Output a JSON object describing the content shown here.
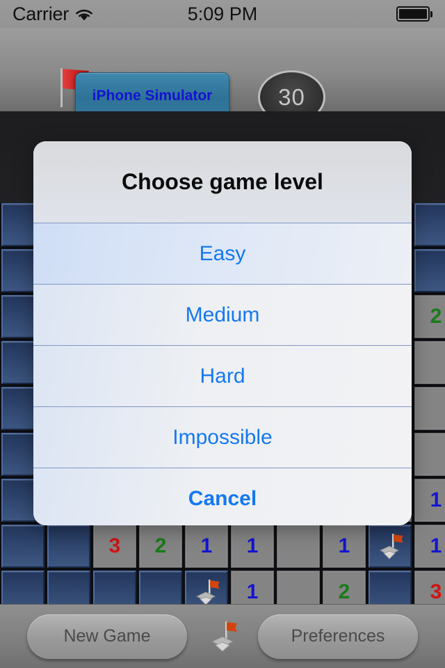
{
  "status_bar": {
    "carrier": "Carrier",
    "wifi_icon": "wifi-icon",
    "time": "5:09 PM",
    "battery_icon": "battery-full-icon"
  },
  "header": {
    "title_button_label": "iPhone Simulator",
    "flag_icon": "red-flag-icon",
    "mine_counter_value": "30"
  },
  "action_sheet": {
    "title": "Choose game level",
    "items": [
      {
        "label": "Easy",
        "highlighted": true,
        "style": "default"
      },
      {
        "label": "Medium",
        "highlighted": false,
        "style": "default"
      },
      {
        "label": "Hard",
        "highlighted": false,
        "style": "default"
      },
      {
        "label": "Impossible",
        "highlighted": false,
        "style": "default"
      },
      {
        "label": "Cancel",
        "highlighted": false,
        "style": "cancel"
      }
    ],
    "accent_color": "#1478f0"
  },
  "toolbar": {
    "new_game_label": "New Game",
    "preferences_label": "Preferences",
    "center_icon": "flag-on-mine-icon"
  },
  "board": {
    "columns": 10,
    "cell_size": 64,
    "colors": {
      "one": "#1414d2",
      "two": "#1a7a1a",
      "three": "#d01414"
    },
    "rows": [
      {
        "cells": [
          {
            "state": "covered",
            "value": ""
          },
          {
            "state": "covered",
            "value": ""
          },
          {
            "state": "covered",
            "value": ""
          },
          {
            "state": "covered",
            "value": ""
          },
          {
            "state": "covered",
            "value": ""
          },
          {
            "state": "covered",
            "value": ""
          },
          {
            "state": "covered",
            "value": ""
          },
          {
            "state": "covered",
            "value": ""
          },
          {
            "state": "covered",
            "value": ""
          },
          {
            "state": "covered",
            "value": ""
          }
        ]
      },
      {
        "cells": [
          {
            "state": "covered",
            "value": ""
          },
          {
            "state": "covered",
            "value": ""
          },
          {
            "state": "covered",
            "value": ""
          },
          {
            "state": "covered",
            "value": ""
          },
          {
            "state": "covered",
            "value": ""
          },
          {
            "state": "covered",
            "value": ""
          },
          {
            "state": "covered",
            "value": ""
          },
          {
            "state": "covered",
            "value": ""
          },
          {
            "state": "covered",
            "value": ""
          },
          {
            "state": "covered",
            "value": ""
          }
        ]
      },
      {
        "cells": [
          {
            "state": "covered",
            "value": ""
          },
          {
            "state": "covered",
            "value": ""
          },
          {
            "state": "revealed",
            "value": ""
          },
          {
            "state": "revealed",
            "value": ""
          },
          {
            "state": "revealed",
            "value": ""
          },
          {
            "state": "revealed",
            "value": ""
          },
          {
            "state": "revealed",
            "value": ""
          },
          {
            "state": "revealed",
            "value": ""
          },
          {
            "state": "revealed",
            "value": ""
          },
          {
            "state": "revealed",
            "value": "2"
          }
        ]
      },
      {
        "cells": [
          {
            "state": "covered",
            "value": ""
          },
          {
            "state": "covered",
            "value": ""
          },
          {
            "state": "revealed",
            "value": ""
          },
          {
            "state": "revealed",
            "value": ""
          },
          {
            "state": "revealed",
            "value": ""
          },
          {
            "state": "revealed",
            "value": ""
          },
          {
            "state": "revealed",
            "value": ""
          },
          {
            "state": "revealed",
            "value": ""
          },
          {
            "state": "revealed",
            "value": ""
          },
          {
            "state": "revealed",
            "value": ""
          }
        ]
      },
      {
        "cells": [
          {
            "state": "covered",
            "value": ""
          },
          {
            "state": "covered",
            "value": ""
          },
          {
            "state": "revealed",
            "value": ""
          },
          {
            "state": "revealed",
            "value": ""
          },
          {
            "state": "revealed",
            "value": ""
          },
          {
            "state": "revealed",
            "value": ""
          },
          {
            "state": "revealed",
            "value": ""
          },
          {
            "state": "revealed",
            "value": ""
          },
          {
            "state": "revealed",
            "value": ""
          },
          {
            "state": "revealed",
            "value": ""
          }
        ]
      },
      {
        "cells": [
          {
            "state": "covered",
            "value": ""
          },
          {
            "state": "covered",
            "value": ""
          },
          {
            "state": "revealed",
            "value": ""
          },
          {
            "state": "revealed",
            "value": ""
          },
          {
            "state": "revealed",
            "value": ""
          },
          {
            "state": "revealed",
            "value": ""
          },
          {
            "state": "revealed",
            "value": ""
          },
          {
            "state": "revealed",
            "value": ""
          },
          {
            "state": "revealed",
            "value": ""
          },
          {
            "state": "revealed",
            "value": ""
          }
        ]
      },
      {
        "cells": [
          {
            "state": "covered",
            "value": ""
          },
          {
            "state": "covered",
            "value": ""
          },
          {
            "state": "revealed",
            "value": ""
          },
          {
            "state": "revealed",
            "value": ""
          },
          {
            "state": "revealed",
            "value": ""
          },
          {
            "state": "revealed",
            "value": ""
          },
          {
            "state": "revealed",
            "value": ""
          },
          {
            "state": "revealed",
            "value": ""
          },
          {
            "state": "revealed",
            "value": ""
          },
          {
            "state": "revealed",
            "value": "1"
          }
        ]
      },
      {
        "cells": [
          {
            "state": "covered",
            "value": ""
          },
          {
            "state": "covered",
            "value": ""
          },
          {
            "state": "revealed",
            "value": "3"
          },
          {
            "state": "revealed",
            "value": "2"
          },
          {
            "state": "revealed",
            "value": "1"
          },
          {
            "state": "revealed",
            "value": "1"
          },
          {
            "state": "revealed",
            "value": ""
          },
          {
            "state": "revealed",
            "value": "1"
          },
          {
            "state": "flag",
            "value": ""
          },
          {
            "state": "revealed",
            "value": "1"
          }
        ]
      },
      {
        "cells": [
          {
            "state": "covered",
            "value": ""
          },
          {
            "state": "covered",
            "value": ""
          },
          {
            "state": "covered",
            "value": ""
          },
          {
            "state": "covered",
            "value": ""
          },
          {
            "state": "flag",
            "value": ""
          },
          {
            "state": "revealed",
            "value": "1"
          },
          {
            "state": "revealed",
            "value": ""
          },
          {
            "state": "revealed",
            "value": "2"
          },
          {
            "state": "covered",
            "value": ""
          },
          {
            "state": "revealed",
            "value": "3"
          }
        ]
      }
    ]
  }
}
